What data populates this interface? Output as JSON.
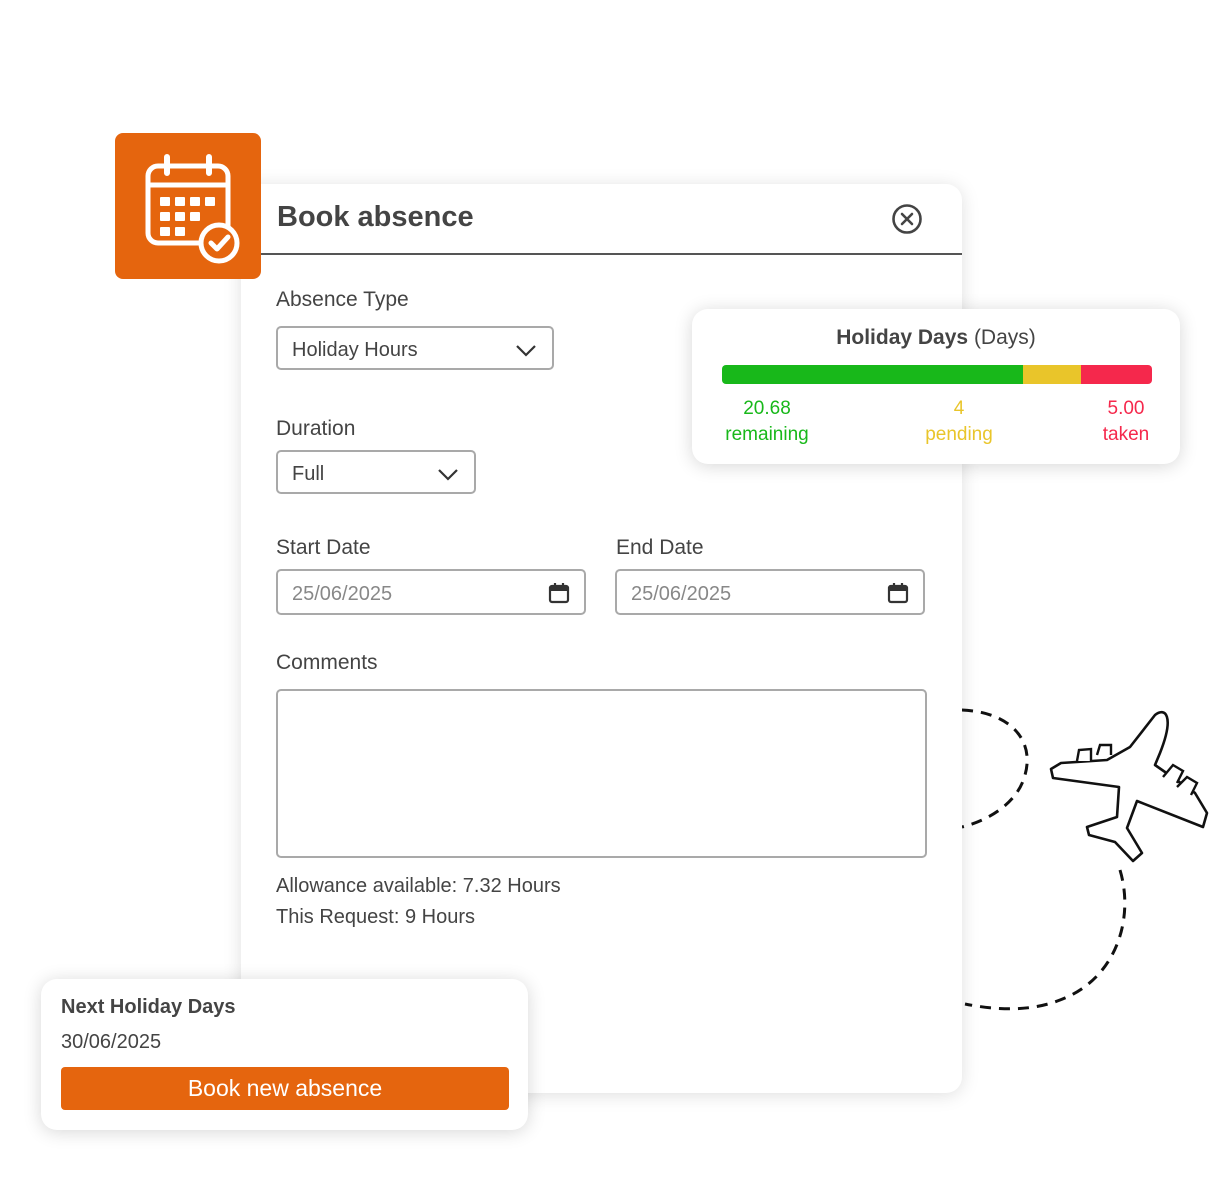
{
  "modal": {
    "title": "Book absence",
    "close_icon": "close-circle-icon",
    "absence_type": {
      "label": "Absence Type",
      "value": "Holiday Hours"
    },
    "duration": {
      "label": "Duration",
      "value": "Full"
    },
    "start_date": {
      "label": "Start Date",
      "value": "25/06/2025"
    },
    "end_date": {
      "label": "End Date",
      "value": "25/06/2025"
    },
    "comments": {
      "label": "Comments",
      "value": ""
    },
    "allowance": "Allowance available: 7.32 Hours",
    "request": "This Request: 9 Hours"
  },
  "holiday_card": {
    "title_bold": "Holiday Days",
    "title_unit": "(Days)",
    "remaining": {
      "value": "20.68",
      "label": "remaining",
      "color": "#18b81a"
    },
    "pending": {
      "value": "4",
      "label": "pending",
      "color": "#e9c52a"
    },
    "taken": {
      "value": "5.00",
      "label": "taken",
      "color": "#f5284c"
    },
    "bar_fractions": {
      "remaining": 0.7,
      "pending": 0.135,
      "taken": 0.165
    }
  },
  "next_holiday": {
    "title": "Next Holiday Days",
    "date": "30/06/2025",
    "button_label": "Book new absence"
  },
  "colors": {
    "accent": "#e5650e"
  },
  "icons": [
    "calendar-check-icon",
    "chevron-down-icon",
    "calendar-icon",
    "airplane-icon"
  ]
}
